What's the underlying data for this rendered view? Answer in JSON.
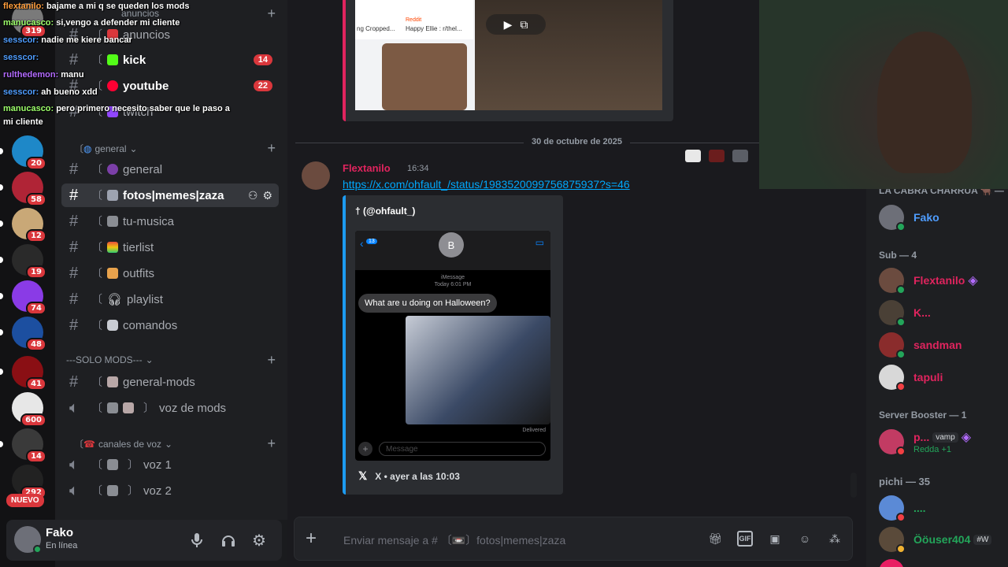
{
  "stream_chat": [
    {
      "user": "flextanilo:",
      "text": "bajame a mi q se queden los mods",
      "color": "#ff9d3c"
    },
    {
      "user": "manucasco:",
      "text": "si,vengo a defender mi cliente",
      "color": "#9dff6b"
    },
    {
      "user": "sesscor:",
      "text": "nadie me kiere bancar",
      "color": "#4f9dff"
    },
    {
      "user": "sesscor:",
      "text": "",
      "color": "#4f9dff"
    },
    {
      "user": "rulthedemon:",
      "text": "manu",
      "color": "#b36bff"
    },
    {
      "user": "sesscor:",
      "text": "ah bueno xdd",
      "color": "#4f9dff"
    },
    {
      "user": "manucasco:",
      "text": "pero primero necesito saber que le paso a",
      "color": "#9dff6b"
    },
    {
      "user": "",
      "text": "mi cliente",
      "color": "#ffffff"
    }
  ],
  "servers": [
    {
      "badge": "319",
      "color": "#7a7a7a"
    },
    {
      "badge": "20",
      "color": "#1e88c8"
    },
    {
      "badge": "58",
      "color": "#b02436"
    },
    {
      "badge": "12",
      "color": "#c9a877"
    },
    {
      "badge": "19",
      "color": "#2a2a2a"
    },
    {
      "badge": "74",
      "color": "#8a3be6"
    },
    {
      "badge": "48",
      "color": "#1c4fa0"
    },
    {
      "badge": "41",
      "color": "#8a0f14"
    },
    {
      "badge": "600",
      "color": "#e7e7e7"
    },
    {
      "badge": "14",
      "color": "#3a3a3a"
    },
    {
      "badge": "292",
      "color": "#222222"
    }
  ],
  "server_nuevo": "NUEVO",
  "categories": {
    "anuncios": "anuncios",
    "general": "general",
    "solo_mods": "---SOLO MODS---",
    "voz": "canales de voz"
  },
  "channels": {
    "anuncios": "anuncios",
    "kick": "kick",
    "kick_count": "14",
    "youtube": "youtube",
    "youtube_count": "22",
    "twitch": "twitch",
    "general": "general",
    "fotos": "fotos|memes|zaza",
    "tu_musica": "tu-musica",
    "tierlist": "tierlist",
    "outfits": "outfits",
    "playlist": "playlist",
    "comandos": "comandos",
    "general_mods": "general-mods",
    "voz_mods": "voz de mods",
    "voz1": "voz 1",
    "voz2": "voz 2"
  },
  "user_panel": {
    "name": "Fako",
    "status": "En línea"
  },
  "main": {
    "embed_top_source": "Reddit",
    "embed_top_caption1": "ng Cropped...",
    "embed_top_caption2": "Happy Ellie : r/thel...",
    "date_divider": "30 de octubre de 2025",
    "message": {
      "author": "Flextanilo",
      "time": "16:34",
      "link": "https://x.com/ohfault_/status/1983520099756875937?s=46"
    },
    "tweet": {
      "author": "† (@ohfault_)",
      "contact_initial": "B",
      "imessage_header": "iMessage",
      "imessage_time": "Today 6:01 PM",
      "bubble_text": "What are u doing on Halloween?",
      "delivered": "Delivered",
      "input_placeholder": "Message",
      "footer": "X • ayer a las 10:03",
      "back_count": "13"
    },
    "composer_placeholder": "Enviar mensaje a # 〔📼〕fotos|memes|zaza"
  },
  "members": {
    "top_group": "LA CABRA CHARRUA 🐂 —",
    "top_member": "Fako",
    "sub_header": "Sub — 4",
    "subs": [
      {
        "name": "Flextanilo",
        "color": "#e0245e"
      },
      {
        "name": "K...",
        "color": "#e0245e"
      },
      {
        "name": "sandman",
        "color": "#e0245e"
      },
      {
        "name": "tapuli",
        "color": "#e0245e"
      }
    ],
    "booster_header": "Server Booster — 1",
    "booster": {
      "name": "p...",
      "chip": "vamp",
      "sub": "Redda +1"
    },
    "pichi_header": "pichi — 35",
    "pichi": [
      {
        "name": "....",
        "color": "#23a55a"
      },
      {
        "name": "Ööuser404",
        "chip": "#W",
        "color": "#23a55a"
      }
    ]
  },
  "colors": {
    "accent": "#5865f2",
    "mention": "#da373c",
    "online": "#23a55a",
    "link": "#00a8fc"
  }
}
